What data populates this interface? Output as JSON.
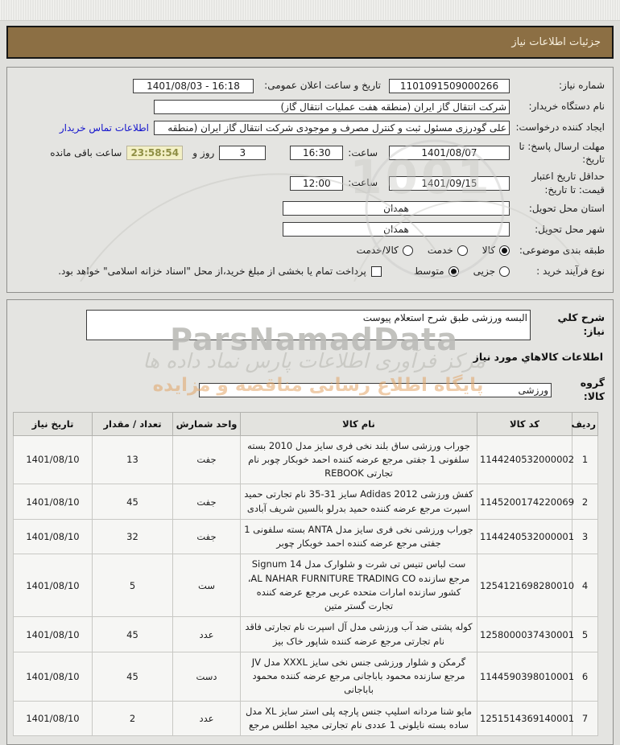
{
  "header": {
    "title": "جزئیات اطلاعات نیاز"
  },
  "form": {
    "need_number": {
      "label": "شماره نیاز:",
      "value": "1101091509000266"
    },
    "announce_datetime": {
      "label": "تاریخ و ساعت اعلان عمومی:",
      "value": "1401/08/03 - 16:18"
    },
    "buyer_org": {
      "label": "نام دستگاه خریدار:",
      "value": "شرکت انتقال گاز ایران (منطقه هفت عملیات انتقال گاز)"
    },
    "request_creator": {
      "label": "ایجاد کننده درخواست:",
      "value": "علی گودرزی مسئول ثبت و کنترل مصرف و موجودی شرکت انتقال گاز ایران (منطقه",
      "contact_link": "اطلاعات تماس خریدار"
    },
    "reply_deadline": {
      "label": "مهلت ارسال پاسخ: تا تاریخ:",
      "date": "1401/08/07",
      "time_label": "ساعت:",
      "time": "16:30",
      "days_value": "3",
      "days_label": "روز و",
      "countdown": "23:58:54",
      "remaining_label": "ساعت باقی مانده"
    },
    "price_validity": {
      "label": "حداقل تاریخ اعتبار قیمت: تا تاریخ:",
      "date": "1401/09/15",
      "time_label": "ساعت:",
      "time": "12:00"
    },
    "delivery_province": {
      "label": "استان محل تحویل:",
      "value": "همدان"
    },
    "delivery_city": {
      "label": "شهر محل تحویل:",
      "value": "همدان"
    },
    "subject_class": {
      "label": "طبقه بندی موضوعی:",
      "options": [
        {
          "label": "کالا",
          "checked": true
        },
        {
          "label": "خدمت",
          "checked": false
        },
        {
          "label": "کالا/خدمت",
          "checked": false
        }
      ]
    },
    "purchase_process": {
      "label": "نوع فرآیند خرید :",
      "options": [
        {
          "label": "جزیی",
          "checked": false
        },
        {
          "label": "متوسط",
          "checked": true
        }
      ],
      "treasury_checkbox_checked": false,
      "treasury_note": "پرداخت تمام یا بخشی از مبلغ خرید،از محل \"اسناد خزانه اسلامی\" خواهد بود."
    }
  },
  "need_section": {
    "desc_label": "شرح کلي نیاز:",
    "desc_value": "البسه ورزشی طبق شرح استعلام پیوست",
    "goods_heading": "اطلاعات کالاهاي مورد نیاز",
    "group_label": "گروه کالا:",
    "group_value": "ورزشی"
  },
  "table": {
    "headers": [
      "ردیف",
      "کد کالا",
      "نام کالا",
      "واحد شمارش",
      "تعداد / مقدار",
      "تاریخ نیاز"
    ],
    "rows": [
      {
        "row": "1",
        "code": "1144240532000002",
        "name": "جوراب ورزشی ساق بلند نخی فری سایز مدل 2010 بسته سلفونی 1 جفتی مرجع عرضه کننده احمد خوبکار چوبر نام تجارتی REBOOK",
        "unit": "جفت",
        "qty": "13",
        "date": "1401/08/10"
      },
      {
        "row": "2",
        "code": "1145200174220069",
        "name": "کفش ورزشی Adidas 2012 سایز 31-35 نام تجارتی حمید اسپرت مرجع عرضه کننده حمید بدرلو بالسین شریف آبادی",
        "unit": "جفت",
        "qty": "45",
        "date": "1401/08/10"
      },
      {
        "row": "3",
        "code": "1144240532000001",
        "name": "جوراب ورزشی نخی فری سایز مدل ANTA بسته سلفونی 1 جفتی مرجع عرضه کننده احمد خوبکار چوبر",
        "unit": "جفت",
        "qty": "32",
        "date": "1401/08/10"
      },
      {
        "row": "4",
        "code": "1254121698280010",
        "name": "ست لباس تنیس تی شرت و شلوارک مدل Signum 14 مرجع سازنده AL NAHAR FURNITURE TRADING CO، کشور سازنده امارات متحده عربی مرجع عرضه کننده تجارت گستر متین",
        "unit": "ست",
        "qty": "5",
        "date": "1401/08/10"
      },
      {
        "row": "5",
        "code": "1258000037430001",
        "name": "کوله پشتی ضد آب ورزشی مدل آل اسپرت نام تجارتی فاقد نام تجارتی مرجع عرضه کننده شاپور خاک بیز",
        "unit": "عدد",
        "qty": "45",
        "date": "1401/08/10"
      },
      {
        "row": "6",
        "code": "1144590398010001",
        "name": "گرمکن و شلوار ورزشی جنس نخی سایز XXXL مدل JV مرجع سازنده محمود باباجانی مرجع عرضه کننده محمود باباجانی",
        "unit": "دست",
        "qty": "45",
        "date": "1401/08/10"
      },
      {
        "row": "7",
        "code": "1251514369140001",
        "name": "مایو شنا مردانه اسلیپ جنس پارچه پلی استر سایز XL مدل ساده بسته نایلونی 1 عددی نام تجارتی مجید اطلس مرجع",
        "unit": "عدد",
        "qty": "2",
        "date": "1401/08/10"
      }
    ]
  },
  "watermarks": {
    "stamp_digits": "1001",
    "brand": "ParsNamadData",
    "calligraphy": "مرکز فرآوری اطلاعات پارس نماد داده ها",
    "slogan": "پایگاه اطلاع رسانی مناقصه و مزایده"
  },
  "colors": {
    "header_bg": "#8c6f44",
    "countdown_bg": "#f3f0c6",
    "link_blue": "#1414cc",
    "slogan_orange": "#e2a668"
  }
}
